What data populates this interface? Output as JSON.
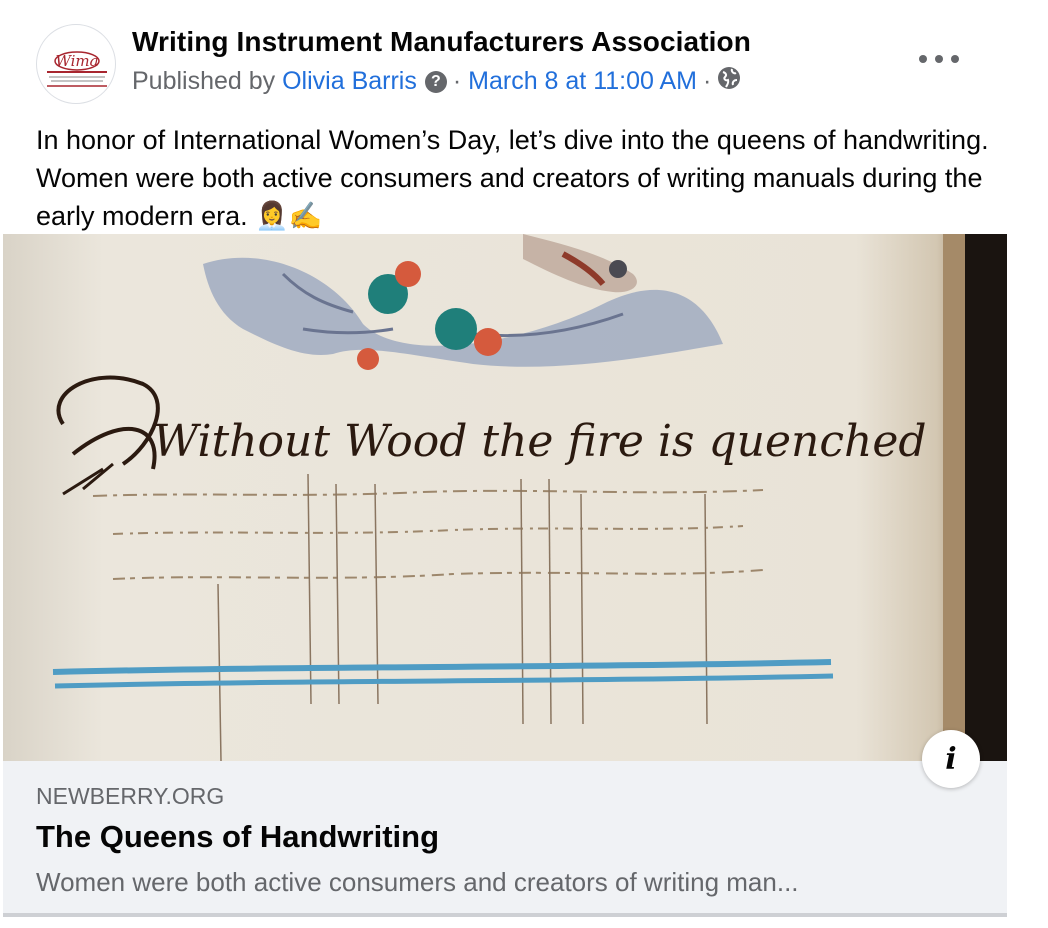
{
  "post": {
    "page_name": "Writing Instrument Manufacturers Association",
    "avatar_logo_text": "Wima",
    "published_by_prefix": "Published by",
    "author": "Olivia Barris",
    "help_glyph": "?",
    "separator": "·",
    "timestamp": "March 8 at 11:00 AM",
    "audience_icon": "globe-icon",
    "more_icon": "more-options-icon",
    "text": "In honor of International Women’s Day, let’s dive into the queens of handwriting. Women were both active consumers and creators of writing manuals during the early modern era. 👩‍💼✍️"
  },
  "link_preview": {
    "image_caption_text": "Without Wood the fire is quenched",
    "info_glyph": "i",
    "domain": "NEWBERRY.ORG",
    "title": "The Queens of Handwriting",
    "description": "Women were both active consumers and creators of writing man..."
  },
  "colors": {
    "link_blue": "#216fdb",
    "secondary_text": "#65676b",
    "preview_bg": "#f0f2f5",
    "ink_brown": "#4a2e1a",
    "stripe_blue": "#4f9cc4"
  }
}
